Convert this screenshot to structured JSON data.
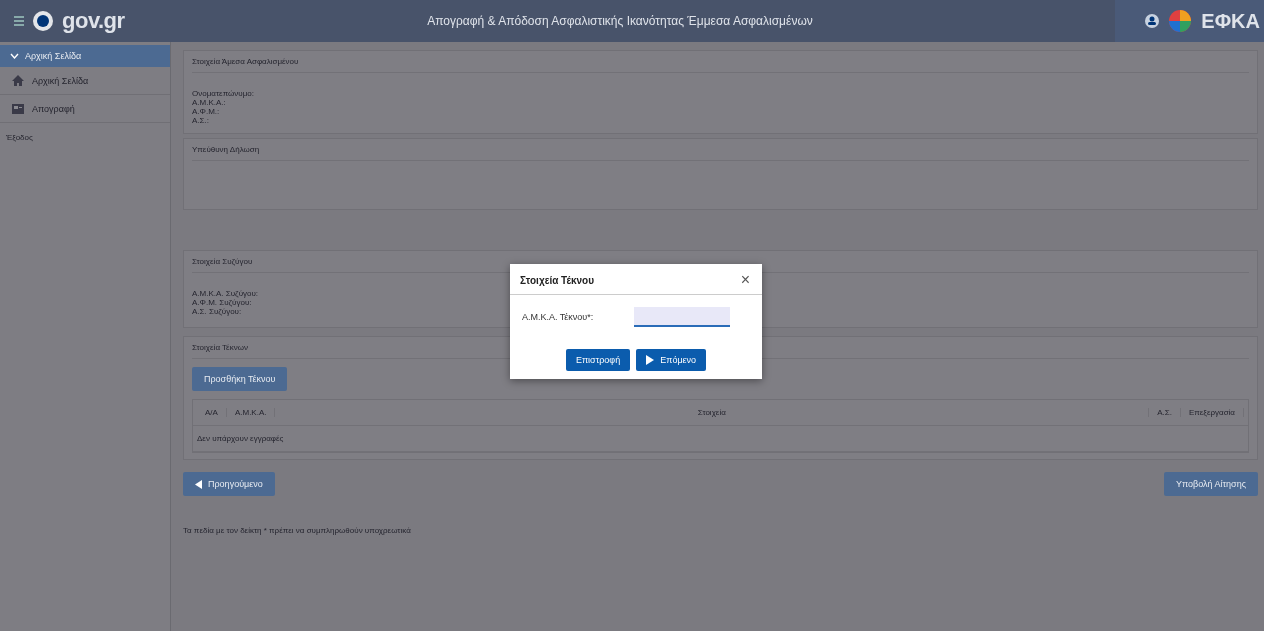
{
  "header": {
    "logo": "gov.gr",
    "title": "Απογραφή & Απόδοση Ασφαλιστικής Ικανότητας Έμμεσα Ασφαλισμένων",
    "brand": "ΕΦΚΑ"
  },
  "sidebar": {
    "section": {
      "label": "Αρχική Σελίδα",
      "expanded": true
    },
    "items": [
      {
        "label": "Αρχική Σελίδα"
      },
      {
        "label": "Απογραφή"
      }
    ],
    "logout": "Έξοδος"
  },
  "insured": {
    "heading": "Στοιχεία Άμεσα Ασφαλισμένου",
    "fields": [
      {
        "label": "Ονοματεπώνυμο:"
      },
      {
        "label": "Α.Μ.Κ.Α.:"
      },
      {
        "label": "Α.Φ.Μ.:"
      },
      {
        "label": "Α.Σ.:"
      }
    ]
  },
  "declaration": {
    "heading": "Υπεύθυνη Δήλωση"
  },
  "spouse": {
    "heading": "Στοιχεία Συζύγου",
    "fields": [
      {
        "label": "Α.Μ.Κ.Α. Συζύγου:"
      },
      {
        "label": "Α.Φ.Μ. Συζύγου:"
      },
      {
        "label": "Α.Σ. Συζύγου:"
      }
    ]
  },
  "children": {
    "heading": "Στοιχεία Τέκνων",
    "add_button": "Προσθήκη Τέκνου",
    "table": {
      "columns": [
        "Α/Α",
        "Α.Μ.Κ.Α.",
        "Στοιχεία",
        "Α.Σ.",
        "Επεξεργασία"
      ],
      "empty": "Δεν υπάρχουν εγγραφές"
    }
  },
  "previous_button": "Προηγούμενο",
  "submit_button": "Υποβολή Αίτησης",
  "note": "Τα πεδία με τον δείκτη * πρέπει να συμπληρωθούν υποχρεωτικά",
  "dialog": {
    "title": "Στοιχεία Τέκνου",
    "close": "×",
    "field": {
      "label": "Α.Μ.Κ.Α. Τέκνου*:"
    },
    "buttons": [
      {
        "label": "Επιστροφή",
        "kind": "back"
      },
      {
        "label": "Επόμενο",
        "kind": "next"
      }
    ]
  }
}
